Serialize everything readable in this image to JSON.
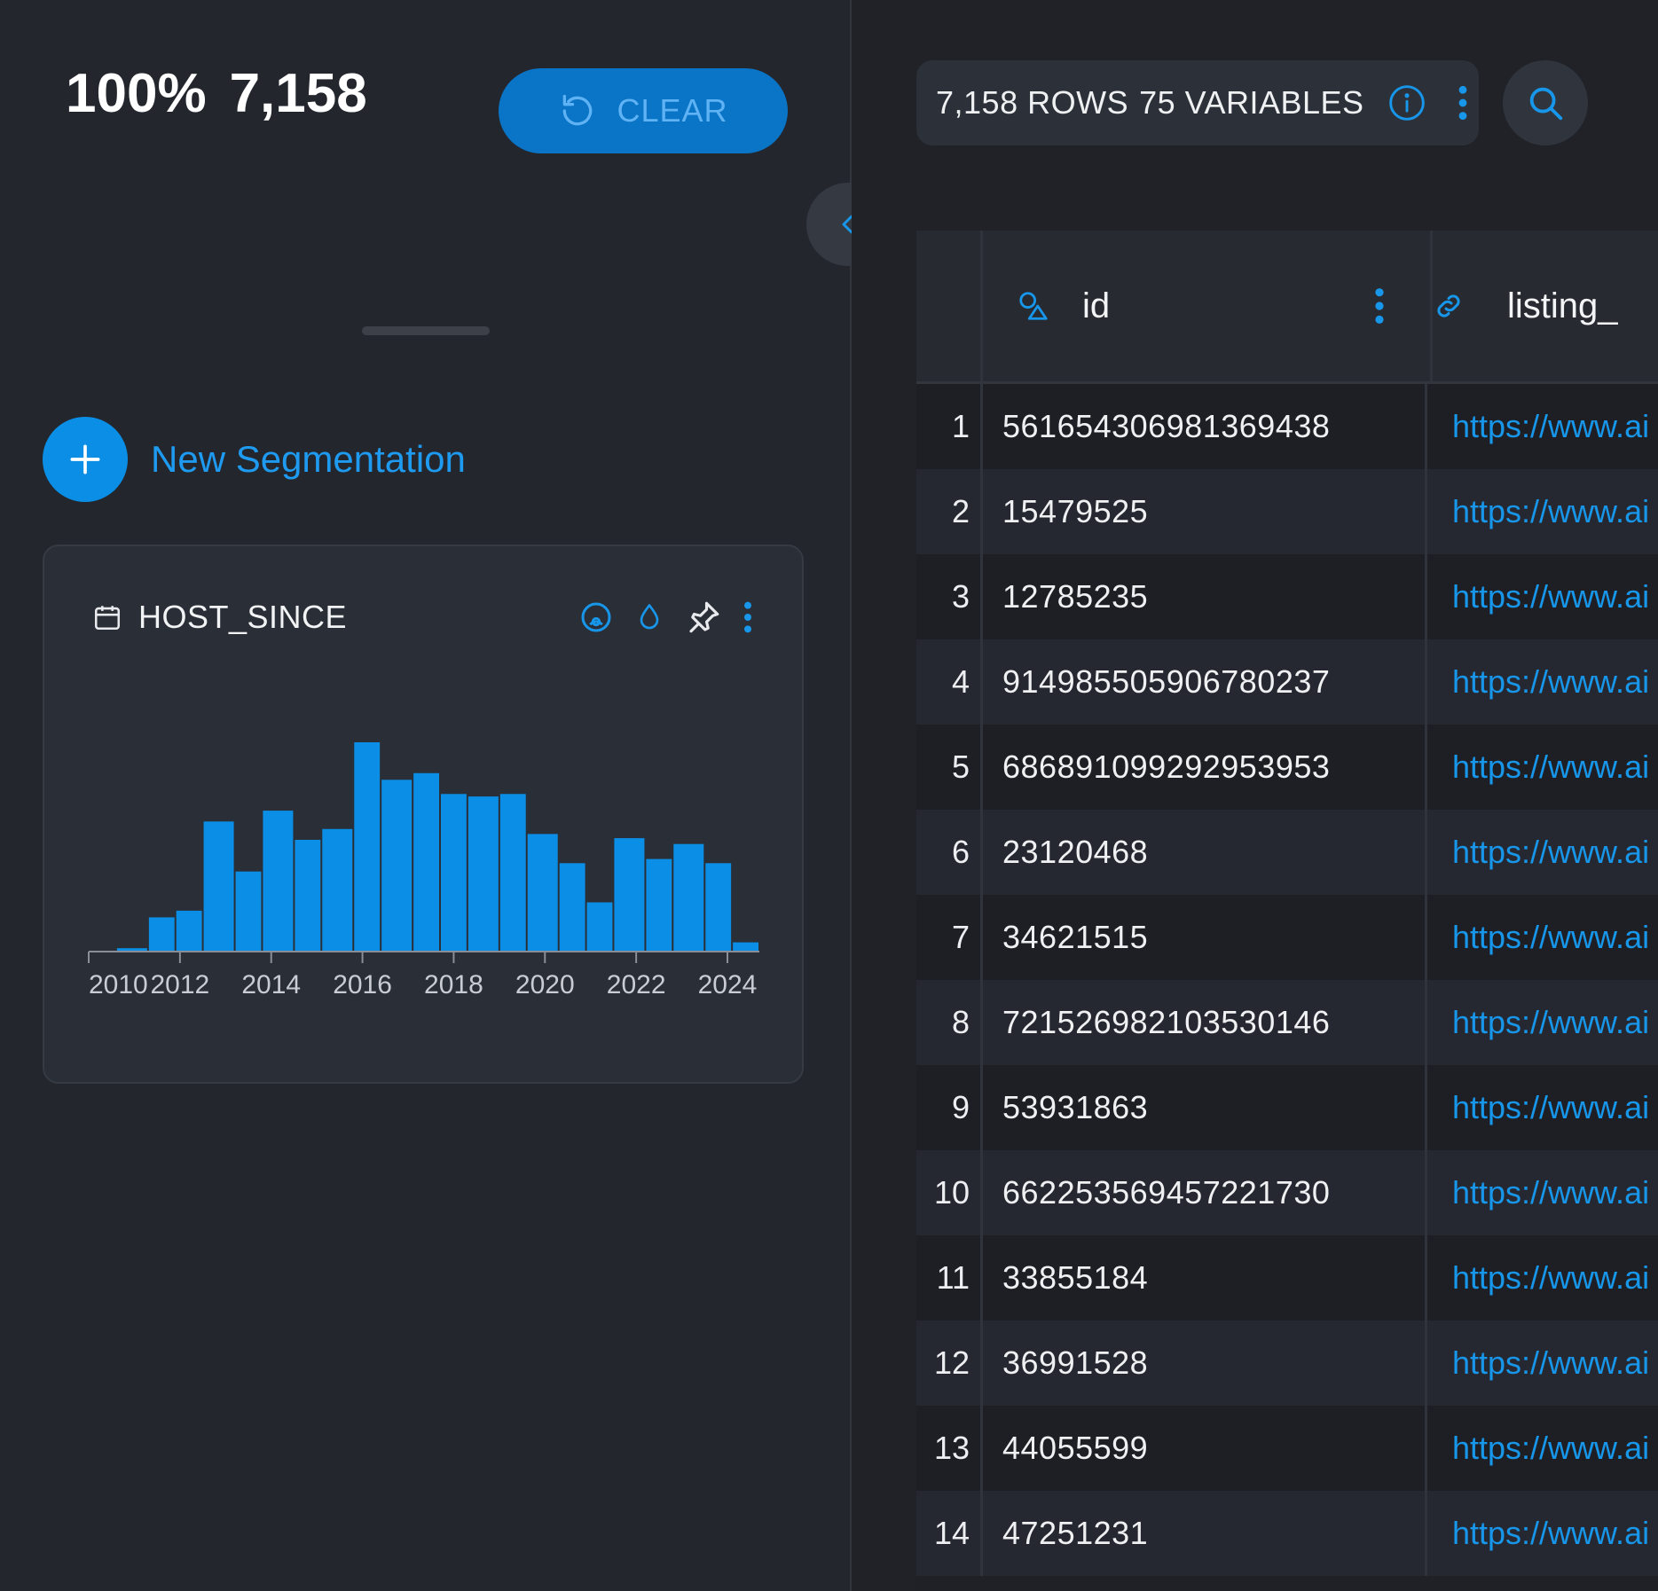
{
  "header": {
    "percent": "100%",
    "count": "7,158",
    "clear_label": "CLEAR"
  },
  "segmentation": {
    "new_label": "New Segmentation"
  },
  "card": {
    "title": "HOST_SINCE"
  },
  "chart_data": {
    "type": "bar",
    "x_tick_labels": [
      "2010",
      "2012",
      "2014",
      "2016",
      "2018",
      "2020",
      "2022",
      "2024"
    ],
    "bin_start_years": [
      2010.0,
      2010.6,
      2011.3,
      2011.9,
      2012.5,
      2013.2,
      2013.8,
      2014.5,
      2015.1,
      2015.8,
      2016.4,
      2017.1,
      2017.7,
      2018.3,
      2019.0,
      2019.6,
      2020.3,
      2020.9,
      2021.5,
      2022.2,
      2022.8,
      2023.5,
      2024.1
    ],
    "values": [
      0,
      3,
      40,
      48,
      155,
      95,
      168,
      133,
      146,
      250,
      205,
      213,
      188,
      185,
      188,
      140,
      105,
      58,
      135,
      110,
      128,
      105,
      10
    ],
    "xlim": [
      2010,
      2024.7
    ],
    "ylim": [
      0,
      250
    ],
    "bar_color": "#0b8fe6"
  },
  "table_meta": {
    "rows_label": "7,158 ROWS",
    "vars_label": "75 VARIABLES"
  },
  "columns": {
    "id": "id",
    "listing": "listing_"
  },
  "rows": [
    {
      "n": "1",
      "id": "561654306981369438",
      "url": "https://www.ai"
    },
    {
      "n": "2",
      "id": "15479525",
      "url": "https://www.ai"
    },
    {
      "n": "3",
      "id": "12785235",
      "url": "https://www.ai"
    },
    {
      "n": "4",
      "id": "914985505906780237",
      "url": "https://www.ai"
    },
    {
      "n": "5",
      "id": "686891099292953953",
      "url": "https://www.ai"
    },
    {
      "n": "6",
      "id": "23120468",
      "url": "https://www.ai"
    },
    {
      "n": "7",
      "id": "34621515",
      "url": "https://www.ai"
    },
    {
      "n": "8",
      "id": "721526982103530146",
      "url": "https://www.ai"
    },
    {
      "n": "9",
      "id": "53931863",
      "url": "https://www.ai"
    },
    {
      "n": "10",
      "id": "662253569457221730",
      "url": "https://www.ai"
    },
    {
      "n": "11",
      "id": "33855184",
      "url": "https://www.ai"
    },
    {
      "n": "12",
      "id": "36991528",
      "url": "https://www.ai"
    },
    {
      "n": "13",
      "id": "44055599",
      "url": "https://www.ai"
    },
    {
      "n": "14",
      "id": "47251231",
      "url": "https://www.ai"
    }
  ],
  "icons": {
    "clear": "refresh-icon",
    "collapse": "chevron-left-icon",
    "add": "plus-icon",
    "calendar": "calendar-icon",
    "info": "info-icon",
    "search": "search-icon"
  }
}
